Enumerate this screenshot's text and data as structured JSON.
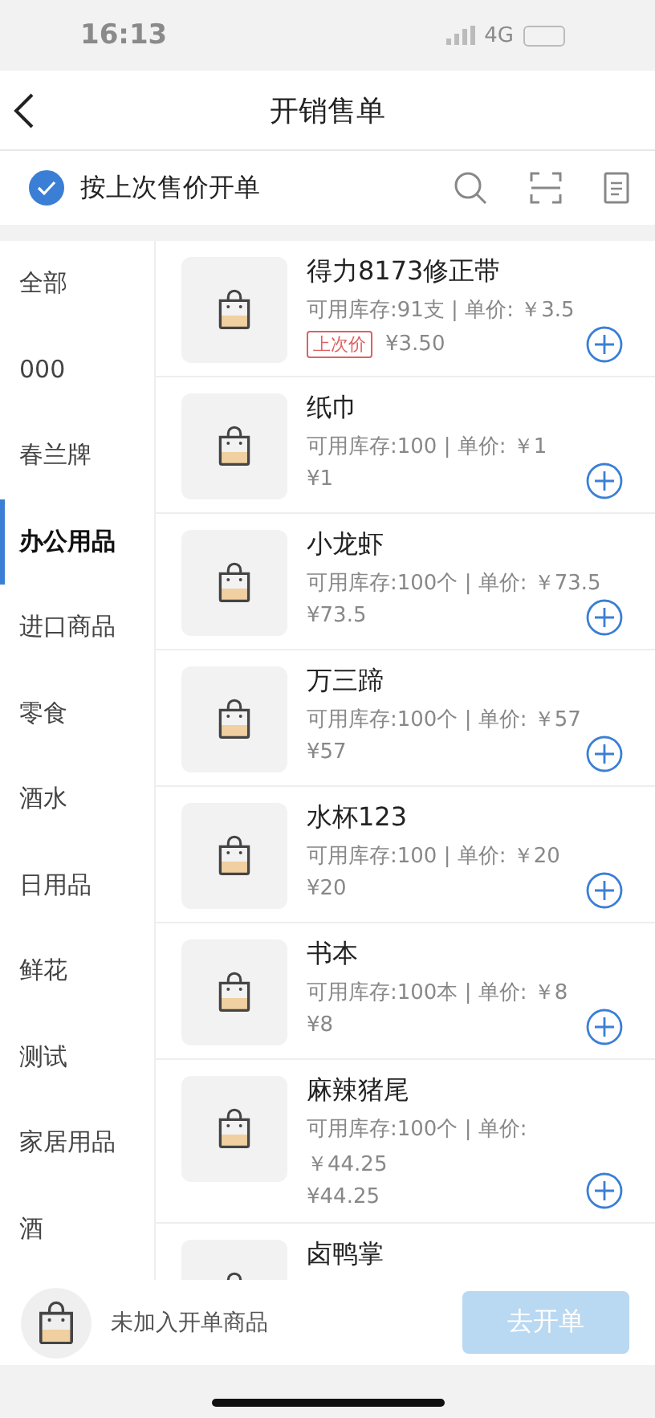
{
  "status_bar": {
    "time": "16:13",
    "network": "4G"
  },
  "header": {
    "title": "开销售单"
  },
  "toolbar": {
    "option": {
      "label": "按上次售价开单",
      "checked": true
    }
  },
  "categories": [
    {
      "label": "全部",
      "selected": false
    },
    {
      "label": "000",
      "selected": false
    },
    {
      "label": "春兰牌",
      "selected": false
    },
    {
      "label": "办公用品",
      "selected": true
    },
    {
      "label": "进口商品",
      "selected": false
    },
    {
      "label": "零食",
      "selected": false
    },
    {
      "label": "酒水",
      "selected": false
    },
    {
      "label": "日用品",
      "selected": false
    },
    {
      "label": "鲜花",
      "selected": false
    },
    {
      "label": "测试",
      "selected": false
    },
    {
      "label": "家居用品",
      "selected": false
    },
    {
      "label": "酒",
      "selected": false
    }
  ],
  "products": [
    {
      "name": "得力8173修正带",
      "stock": [
        "可用库存:91支 | 单价: ￥3.5"
      ],
      "badge": "上次价",
      "price": "¥3.50"
    },
    {
      "name": "纸巾",
      "stock": [
        "可用库存:100 | 单价: ￥1"
      ],
      "price": "¥1"
    },
    {
      "name": "小龙虾",
      "stock": [
        "可用库存:100个 | 单价: ￥73.5"
      ],
      "price": "¥73.5"
    },
    {
      "name": "万三蹄",
      "stock": [
        "可用库存:100个 | 单价: ￥57"
      ],
      "price": "¥57"
    },
    {
      "name": "水杯123",
      "stock": [
        "可用库存:100 | 单价: ￥20"
      ],
      "price": "¥20"
    },
    {
      "name": "书本",
      "stock": [
        "可用库存:100本 | 单价: ￥8"
      ],
      "price": "¥8"
    },
    {
      "name": "麻辣猪尾",
      "stock": [
        "可用库存:100个 | 单价:",
        "￥44.25"
      ],
      "price": "¥44.25"
    },
    {
      "name": "卤鸭掌"
    }
  ],
  "footer": {
    "cart_label": "未加入开单商品",
    "submit": {
      "label": "去开单",
      "disabled": true
    }
  }
}
